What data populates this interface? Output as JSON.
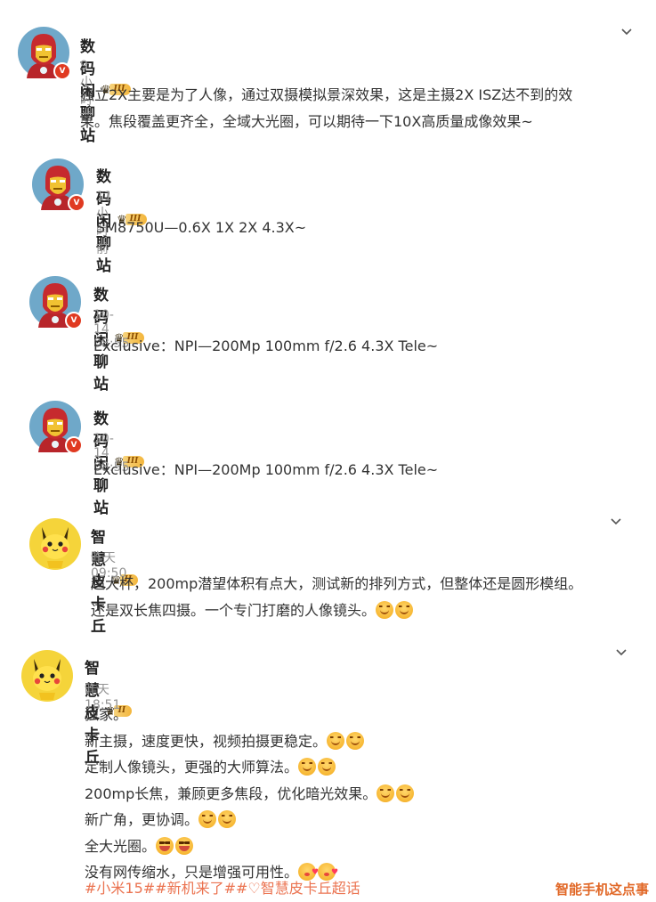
{
  "posts": [
    {
      "author": "数码闲聊站",
      "rank": "III",
      "time": "9小时前",
      "lines": [
        "独立2X主要是为了人像，通过双摄模拟景深效果，这是主摄2X ISZ达不到的效",
        "果。焦段覆盖更齐全，全域大光圈，可以期待一下10X高质量成像效果~"
      ]
    },
    {
      "author": "数码闲聊站",
      "rank": "III",
      "time": "11小时前",
      "lines": [
        "SM8750U—0.6X 1X 2X 4.3X~"
      ]
    },
    {
      "author": "数码闲聊站",
      "rank": "III",
      "time": "10-14 08:55",
      "lines": [
        "Exclusive：NPI—200Mp 100mm f/2.6 4.3X Tele~"
      ]
    },
    {
      "author": "数码闲聊站",
      "rank": "III",
      "time": "10-14 08:55",
      "lines": [
        "Exclusive：NPI—200Mp 100mm f/2.6 4.3X Tele~"
      ]
    },
    {
      "author": "智慧皮卡丘",
      "rank": "II",
      "time": "昨天 09:50",
      "lines": [
        "超大杯，200mp潜望体积有点大，测试新的排列方式，但整体还是圆形模组。",
        "还是双长焦四摄。一个专门打磨的人像镜头。"
      ]
    },
    {
      "author": "智慧皮卡丘",
      "rank": "II",
      "time": "昨天 18:51",
      "lines": [
        "独家。",
        "新主摄，速度更快，视频拍摄更稳定。",
        "定制人像镜头，更强的大师算法。",
        "200mp长焦，兼顾更多焦段，优化暗光效果。",
        "新广角，更协调。",
        "全大光圈。",
        "没有网传缩水，只是增强可用性。"
      ],
      "hashtags": "#小米15##新机来了#",
      "super_topic": "智慧皮卡丘超话"
    }
  ],
  "icons": {
    "verified": "verified-badge-icon",
    "crown": "crown-icon",
    "chevron": "chevron-down-icon",
    "emoji_clap": "clap-emoji-icon",
    "emoji_grin": "grin-emoji-icon",
    "emoji_kiss": "kiss-emoji-icon"
  },
  "colors": {
    "accent": "#eb7350",
    "verified": "#e03a21",
    "time": "#939393"
  },
  "watermark": "智能手机这点事"
}
